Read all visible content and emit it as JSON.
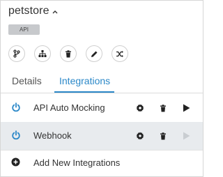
{
  "header": {
    "title": "petstore",
    "badge": "API"
  },
  "actions": [
    {
      "icon": "git-branch-icon"
    },
    {
      "icon": "sitemap-icon"
    },
    {
      "icon": "trash-icon"
    },
    {
      "icon": "pencil-icon"
    },
    {
      "icon": "shuffle-icon"
    }
  ],
  "tabs": {
    "details": "Details",
    "integrations": "Integrations",
    "active": "Integrations"
  },
  "integrations": [
    {
      "name": "API Auto Mocking",
      "enabled": true,
      "play_enabled": true
    },
    {
      "name": "Webhook",
      "enabled": true,
      "play_enabled": false
    }
  ],
  "add_label": "Add New Integrations",
  "colors": {
    "accent": "#2b88c8",
    "icon_dark": "#222222",
    "disabled": "#c9cdd1",
    "selected_row": "#e8ebee"
  }
}
